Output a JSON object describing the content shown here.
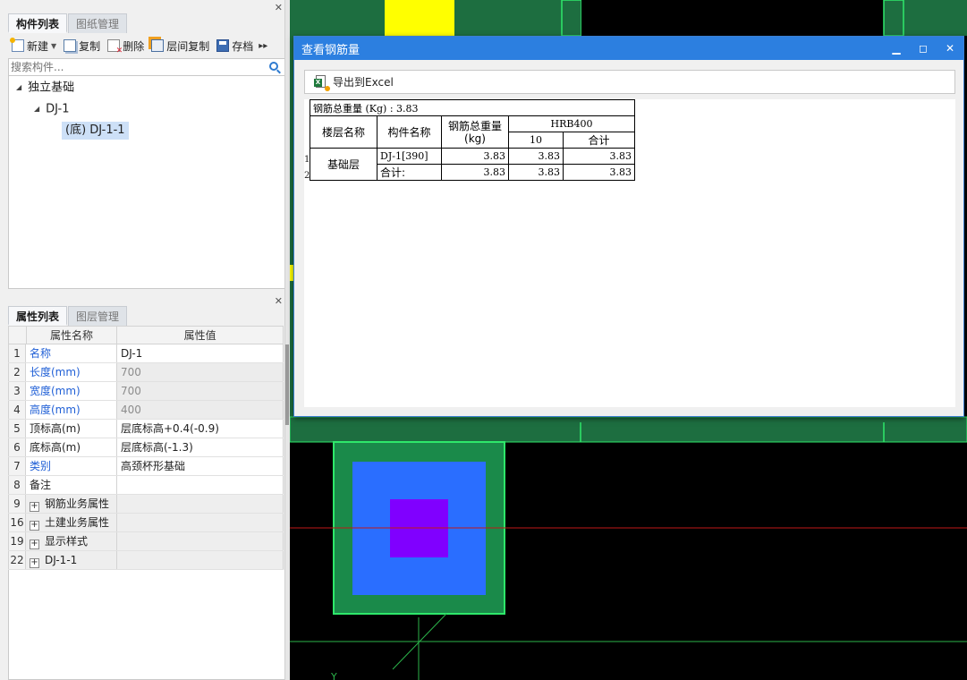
{
  "left_panel": {
    "top_tabs": [
      "构件列表",
      "图纸管理"
    ],
    "toolbar": {
      "new_label": "新建",
      "copy_label": "复制",
      "delete_label": "删除",
      "floor_copy_label": "层间复制",
      "save_label": "存档"
    },
    "search_placeholder": "搜索构件...",
    "tree": {
      "root": "独立基础",
      "child": "DJ-1",
      "leaf": "(底) DJ-1-1"
    },
    "bottom_tabs": [
      "属性列表",
      "图层管理"
    ],
    "properties": {
      "header_name": "属性名称",
      "header_value": "属性值",
      "rows": [
        {
          "num": "1",
          "name": "名称",
          "value": "DJ-1"
        },
        {
          "num": "2",
          "name": "长度(mm)",
          "value": "700"
        },
        {
          "num": "3",
          "name": "宽度(mm)",
          "value": "700"
        },
        {
          "num": "4",
          "name": "高度(mm)",
          "value": "400"
        },
        {
          "num": "5",
          "name": "顶标高(m)",
          "value": "层底标高+0.4(-0.9)"
        },
        {
          "num": "6",
          "name": "底标高(m)",
          "value": "层底标高(-1.3)"
        },
        {
          "num": "7",
          "name": "类别",
          "value": "高颈杯形基础"
        },
        {
          "num": "8",
          "name": "备注",
          "value": ""
        },
        {
          "num": "9",
          "name": "钢筋业务属性",
          "value": ""
        },
        {
          "num": "16",
          "name": "土建业务属性",
          "value": ""
        },
        {
          "num": "19",
          "name": "显示样式",
          "value": ""
        },
        {
          "num": "22",
          "name": "DJ-1-1",
          "value": ""
        }
      ]
    }
  },
  "dialog": {
    "title": "查看钢筋量",
    "export_label": "导出到Excel",
    "table": {
      "summary": "钢筋总重量 (Kg) : 3.83",
      "col_floor": "楼层名称",
      "col_component": "构件名称",
      "col_total": "钢筋总重量\n(kg)",
      "grade": "HRB400",
      "diameter": "10",
      "subtotal": "合计",
      "floor_name": "基础层",
      "rows": [
        {
          "index": "1",
          "component": "DJ-1[390]",
          "total": "3.83",
          "d10": "3.83",
          "sum": "3.83"
        },
        {
          "index": "2",
          "component": "合计:",
          "total": "3.83",
          "d10": "3.83",
          "sum": "3.83"
        }
      ]
    }
  },
  "cad": {
    "axis_label": "Y"
  },
  "colors": {
    "title_bar": "#2c7fe0",
    "cad_bg": "#000000",
    "footing_outer": "#1a8a4a",
    "footing_mid": "#2a6eff",
    "footing_inner": "#8000ff",
    "highlight": "#ffff00"
  }
}
